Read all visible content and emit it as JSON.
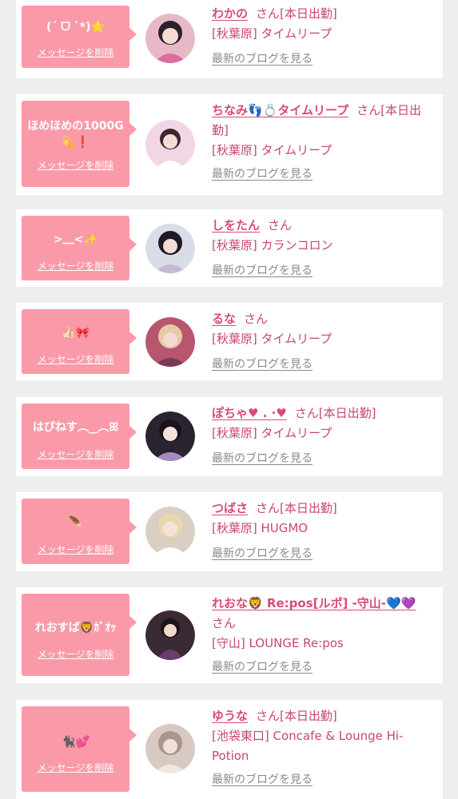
{
  "delete_label": "メッセージを削除",
  "blog_label": "最新のブログを見る",
  "san_label": "さん",
  "colors": {
    "accent": "#d94c72",
    "message_bg": "#fa9aa8",
    "card_bg": "#ffffff",
    "page_bg": "#eeeeee"
  },
  "cards": [
    {
      "message": "(ˊ ᗜ ˋ*)🌟",
      "name": "わかの",
      "status": "[本日出勤]",
      "shop": "[秋葉原] タイムリープ"
    },
    {
      "message": "ほめほめの1000G 💫❗️",
      "name": "ちなみ👣💍タイムリープ",
      "status": "[本日出勤]",
      "shop": "[秋葉原] タイムリープ"
    },
    {
      "message": ">﹏<✨",
      "name": "しをたん",
      "status": "",
      "shop": "[秋葉原] カランコロン"
    },
    {
      "message": "👍🏻🎀",
      "name": "るな",
      "status": "",
      "shop": "[秋葉原] タイムリープ"
    },
    {
      "message": "はぴねす︵‿︵ꕤ",
      "name": "ぽちゃ♥︎ . ·♥︎",
      "status": "[本日出勤]",
      "shop": "[秋葉原] タイムリープ"
    },
    {
      "message": "🪶",
      "name": "つばさ",
      "status": "[本日出勤]",
      "shop": "[秋葉原] HUGMO"
    },
    {
      "message": "れおすば🦁ｶﾞｵｯ",
      "name": "れおな🦁 Re:pos[ルポ] -守山-💙💜",
      "status": "",
      "shop": "[守山] LOUNGE Re:pos"
    },
    {
      "message": "🐈‍⬛💕",
      "name": "ゆうな",
      "status": "[本日出勤]",
      "shop": "[池袋東口] Concafe & Lounge Hi-Potion"
    }
  ]
}
